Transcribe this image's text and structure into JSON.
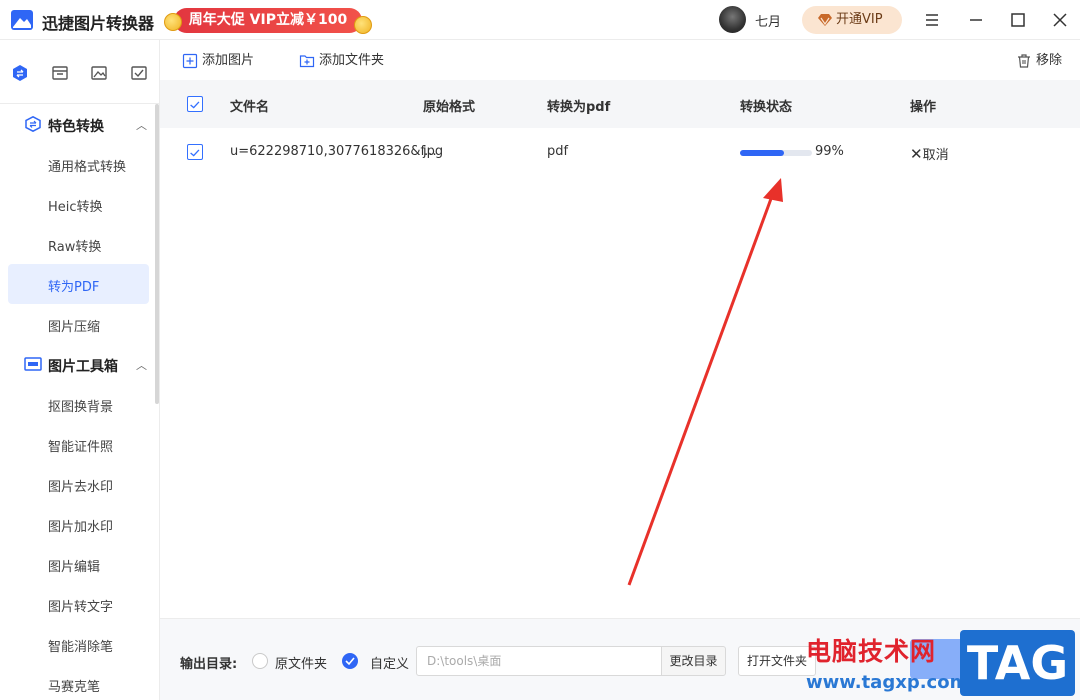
{
  "app": {
    "title": "迅捷图片转换器",
    "promo": "周年大促 VIP立减￥100",
    "username": "七月",
    "vip_button": "开通VIP"
  },
  "colors": {
    "accent": "#2f66f5",
    "promo_red": "#e2363f",
    "annotation_arrow": "#e8312a"
  },
  "sidebar": {
    "groups": [
      {
        "label": "特色转换",
        "icon": "swap-icon",
        "items": [
          "通用格式转换",
          "Heic转换",
          "Raw转换",
          "转为PDF",
          "图片压缩"
        ]
      },
      {
        "label": "图片工具箱",
        "icon": "toolbox-icon",
        "items": [
          "抠图换背景",
          "智能证件照",
          "图片去水印",
          "图片加水印",
          "图片编辑",
          "图片转文字",
          "智能消除笔",
          "马赛克笔"
        ]
      }
    ],
    "active_item": "转为PDF"
  },
  "toolbar": {
    "add_image": "添加图片",
    "add_folder": "添加文件夹",
    "remove": "移除"
  },
  "table": {
    "headers": [
      "文件名",
      "原始格式",
      "转换为pdf",
      "转换状态",
      "操作"
    ],
    "rows": [
      {
        "filename": "u=622298710,3077618326&f...",
        "original_format": "jpg",
        "target_format": "pdf",
        "progress": 99,
        "progress_text": "99%",
        "action": "取消"
      }
    ]
  },
  "footer": {
    "output_label": "输出目录:",
    "option_original": "原文件夹",
    "option_custom": "自定义",
    "path": "D:\\tools\\桌面",
    "change_dir": "更改目录",
    "open_folder": "打开文件夹"
  },
  "watermark": {
    "text": "电脑技术网",
    "url": "www.tagxp.com",
    "tag": "TAG"
  }
}
